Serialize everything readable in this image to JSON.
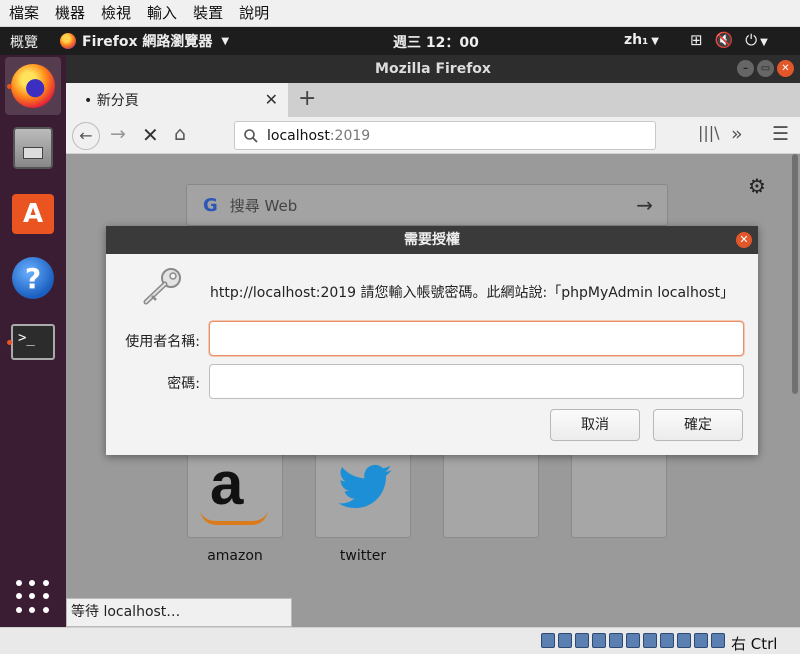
{
  "vbox_menu": [
    "檔案",
    "機器",
    "檢視",
    "輸入",
    "裝置",
    "說明"
  ],
  "topbar": {
    "activities": "概覽",
    "app_name": "Firefox 網路瀏覽器",
    "clock": "週三 12：00",
    "lang": "zh₁"
  },
  "firefox": {
    "window_title": "Mozilla Firefox",
    "tab_title": "• 新分頁",
    "url_host": "localhost",
    "url_port": ":2019",
    "search_placeholder": "搜尋 Web",
    "tiles": [
      {
        "label": "amazon"
      },
      {
        "label": "twitter"
      }
    ],
    "status_text": "等待 localhost…"
  },
  "dialog": {
    "title": "需要授權",
    "message": "http://localhost:2019 請您輸入帳號密碼。此網站說:「phpMyAdmin localhost」",
    "username_label": "使用者名稱:",
    "password_label": "密碼:",
    "username_value": "",
    "password_value": "",
    "cancel_label": "取消",
    "ok_label": "確定"
  },
  "vbox_status": {
    "host_key": "右 Ctrl"
  },
  "colors": {
    "accent": "#e95420",
    "dock_bg": "#3b1d33",
    "topbar_bg": "#1d1d1d"
  }
}
